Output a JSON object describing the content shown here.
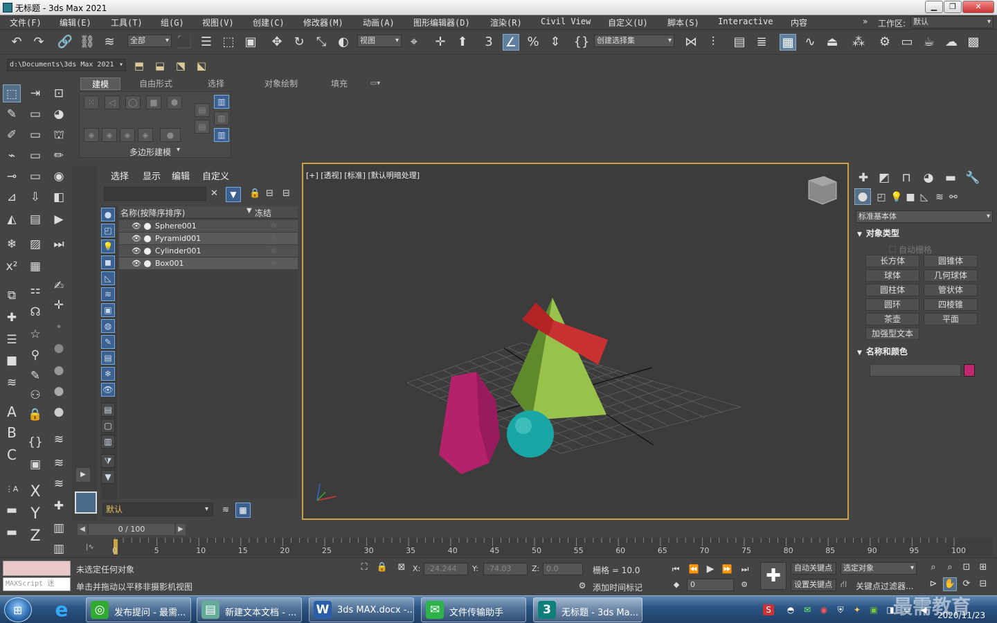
{
  "window": {
    "title": "无标题 - 3ds Max 2021"
  },
  "menus": [
    "文件(F)",
    "编辑(E)",
    "工具(T)",
    "组(G)",
    "视图(V)",
    "创建(C)",
    "修改器(M)",
    "动画(A)",
    "图形编辑器(D)",
    "渲染(R)",
    "Civil View",
    "自定义(U)",
    "脚本(S)",
    "Interactive",
    "内容"
  ],
  "workspace": {
    "label": "工作区:",
    "value": "默认"
  },
  "toolbar": {
    "filter": "全部",
    "ref_coord": "视图",
    "selection_set": "创建选择集"
  },
  "project_path": "d:\\Documents\\3ds Max 2021",
  "ribbon": {
    "tabs": [
      "建模",
      "自由形式",
      "选择",
      "对象绘制",
      "填充"
    ],
    "group_label": "多边形建模"
  },
  "explorer": {
    "menu": [
      "选择",
      "显示",
      "编辑",
      "自定义"
    ],
    "col_name": "名称(按降序排序)",
    "col_frozen": "冻结",
    "objects": [
      "Sphere001",
      "Pyramid001",
      "Cylinder001",
      "Box001"
    ],
    "layer": "默认"
  },
  "viewport": {
    "label": "[+] [透视] [标准] [默认明暗处理]"
  },
  "command_panel": {
    "category": "标准基本体",
    "rollout_object_type": "对象类型",
    "autogrid": "自动栅格",
    "buttons": [
      "长方体",
      "圆锥体",
      "球体",
      "几何球体",
      "圆柱体",
      "管状体",
      "圆环",
      "四棱锥",
      "茶壶",
      "平面",
      "加强型文本"
    ],
    "rollout_name_color": "名称和颜色",
    "object_color": "#c2266e"
  },
  "timeline": {
    "frame": "0 / 100",
    "ticks": [
      "0",
      "5",
      "10",
      "15",
      "20",
      "25",
      "30",
      "35",
      "40",
      "45",
      "50",
      "55",
      "60",
      "65",
      "70",
      "75",
      "80",
      "85",
      "90",
      "95",
      "100"
    ]
  },
  "status": {
    "maxscript": "MAXScript 迷",
    "msg1": "未选定任何对象",
    "msg2": "单击并拖动以平移非摄影机视图",
    "x_label": "X:",
    "x": "-24.244",
    "y_label": "Y:",
    "y": "-74.03",
    "z_label": "Z:",
    "z": "0.0",
    "grid": "栅格 = 10.0",
    "add_time_tag": "添加时间标记",
    "auto_key": "自动关键点",
    "sel_obj": "选定对象",
    "set_key": "设置关键点",
    "key_filter": "关键点过滤器...",
    "frame_field": "0"
  },
  "taskbar": {
    "tasks": [
      "发布提问 - 最需...",
      "新建文本文档 - ...",
      "3ds MAX.docx -...",
      "文件传输助手",
      "无标题 - 3ds Ma..."
    ],
    "date": "2020/11/23",
    "watermark": "最需教育"
  }
}
